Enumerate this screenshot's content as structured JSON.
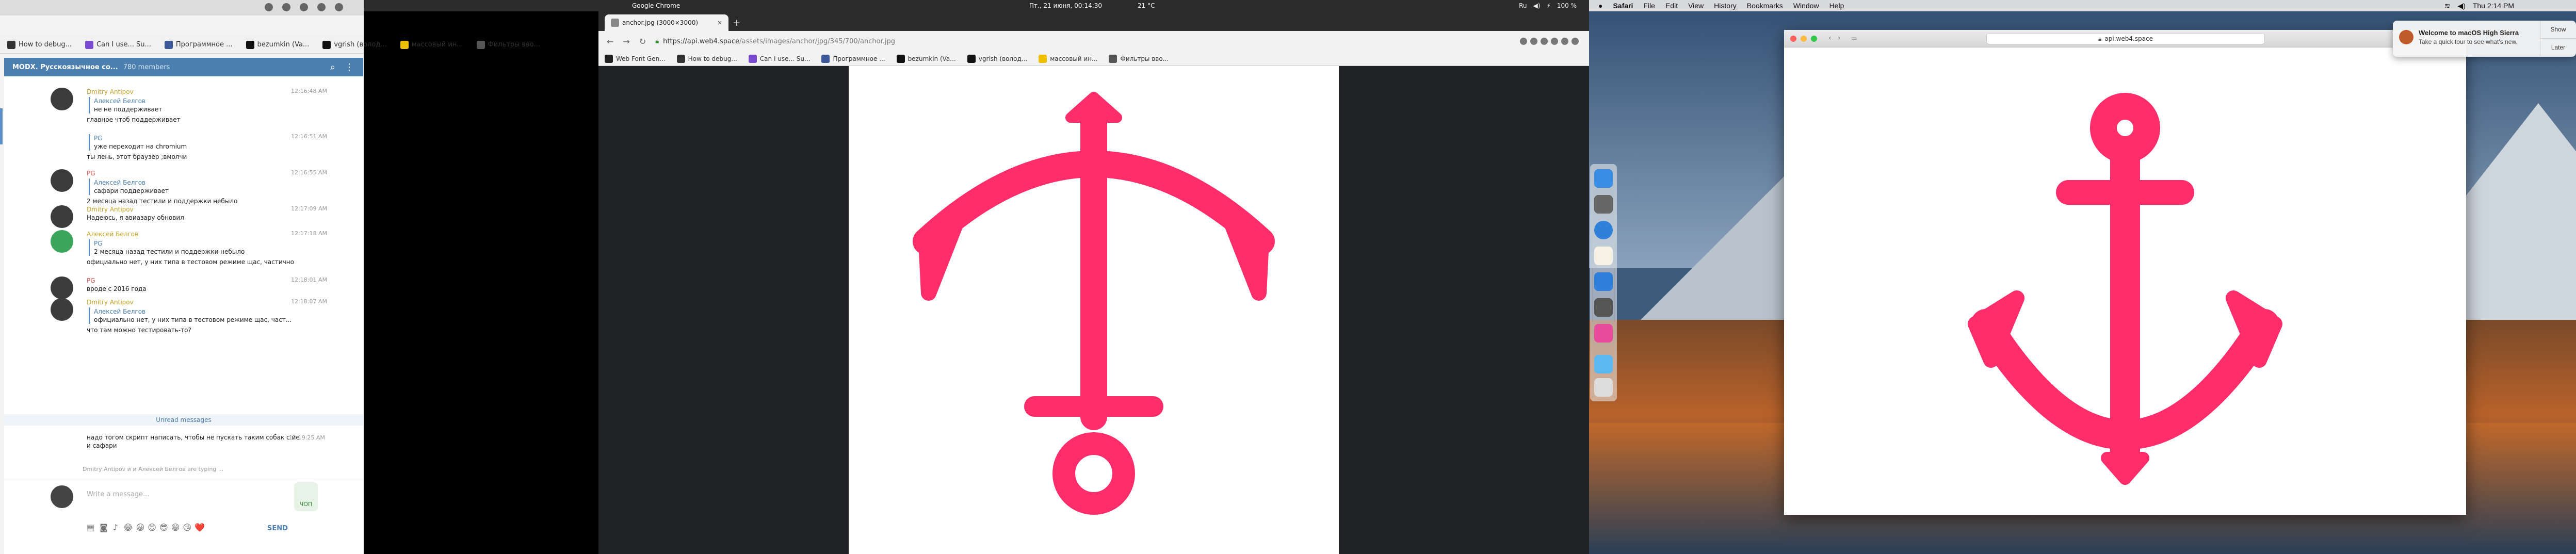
{
  "panel1": {
    "bookmarks": [
      {
        "label": "How to debug...",
        "color": "#333333"
      },
      {
        "label": "Can I use... Su...",
        "color": "#7a4ad0"
      },
      {
        "label": "Программное ...",
        "color": "#3b5998"
      },
      {
        "label": "bezumkin (Va...",
        "color": "#111111"
      },
      {
        "label": "vgrish (волод...",
        "color": "#111111"
      },
      {
        "label": "массовый ин...",
        "color": "#f0c000"
      },
      {
        "label": "Фильтры вво...",
        "color": "#555555"
      }
    ],
    "telegram": {
      "title": "MODX. Русскоязычное со...",
      "members": "780 members",
      "messages": [
        {
          "name": "Dmitry Antipov",
          "time": "12:16:48 AM",
          "quote_name": "Алексей Белгов",
          "quote_text": "не не поддерживает",
          "text": "главное чтоб поддерживает"
        },
        {
          "name": "",
          "time": "12:16:51 AM",
          "quote_name": "PG",
          "quote_text": "уже переходит на chromium",
          "text": "ты лень, этот браузер ;вмолчи"
        },
        {
          "name": "PG",
          "time": "12:16:55 AM",
          "quote_name": "Алексей Белгов",
          "quote_text": "сафари поддерживает",
          "text": "2 месяца назад тестили и поддержки небыло"
        },
        {
          "name": "Dmitry Antipov",
          "time": "12:17:09 AM",
          "quote_name": "",
          "quote_text": "",
          "text": "Надеюсь, я авиазару обновил"
        },
        {
          "name": "Алексей Белгов",
          "time": "12:17:18 AM",
          "quote_name": "PG",
          "quote_text": "2 месяца назад тестили и поддержки небыло",
          "text": "официально нет, у них типа в тестовом режиме щас, частично"
        },
        {
          "name": "PG",
          "time": "12:18:01 AM",
          "quote_name": "",
          "quote_text": "",
          "text": "вроде с 2016 года"
        },
        {
          "name": "Dmitry Antipov",
          "time": "12:18:07 AM",
          "quote_name": "Алексей Белгов",
          "quote_text": "официально нет, у них типа в тестовом режиме щас, част...",
          "text": "что там можно тестировать-то?"
        }
      ],
      "unread_label": "Unread messages",
      "last_message": {
        "time": "12:19:25 AM",
        "text": "надо тогом скрипт написать, чтобы не пускать таким собак с ие и сафари"
      },
      "typing": "Dmitry Antipov и и Алексей Белгов are typing ...",
      "compose_placeholder": "Write a message...",
      "sticker_label": "ЧОП",
      "send_label": "SEND",
      "emoji": [
        "😂",
        "😀",
        "😊",
        "😎",
        "😁",
        "😘",
        "❤️"
      ]
    }
  },
  "topbar": {
    "title": "Google Chrome",
    "clock": "Пт., 21 июня, 00:14:30",
    "temp": "21 °C",
    "tray": [
      "Ru",
      "◀)",
      "⚡",
      "100 %"
    ]
  },
  "panel2": {
    "tab_title": "anchor.jpg (3000×3000)",
    "url_host": "https://api.web4.space",
    "url_path": "/assets/images/anchor/jpg/345/700/anchor.jpg",
    "bookmarks": [
      {
        "label": "Web Font Gen...",
        "color": "#222222"
      },
      {
        "label": "How to debug...",
        "color": "#333333"
      },
      {
        "label": "Can I use... Su...",
        "color": "#7a4ad0"
      },
      {
        "label": "Программное ...",
        "color": "#3b5998"
      },
      {
        "label": "bezumkin (Va...",
        "color": "#111111"
      },
      {
        "label": "vgrish (волод...",
        "color": "#111111"
      },
      {
        "label": "массовый ин...",
        "color": "#f0c000"
      },
      {
        "label": "Фильтры вво...",
        "color": "#555555"
      }
    ],
    "anchor_color": "#ff2d6a"
  },
  "panel3": {
    "menu": [
      "Safari",
      "File",
      "Edit",
      "View",
      "History",
      "Bookmarks",
      "Window",
      "Help"
    ],
    "clock": "Thu 2:14 PM",
    "safari_url": "api.web4.space",
    "notification": {
      "title": "Welcome to macOS High Sierra",
      "body": "Take a quick tour to see what's new.",
      "buttons": [
        "Show",
        "Later"
      ]
    },
    "anchor_color": "#ff2d6a"
  }
}
